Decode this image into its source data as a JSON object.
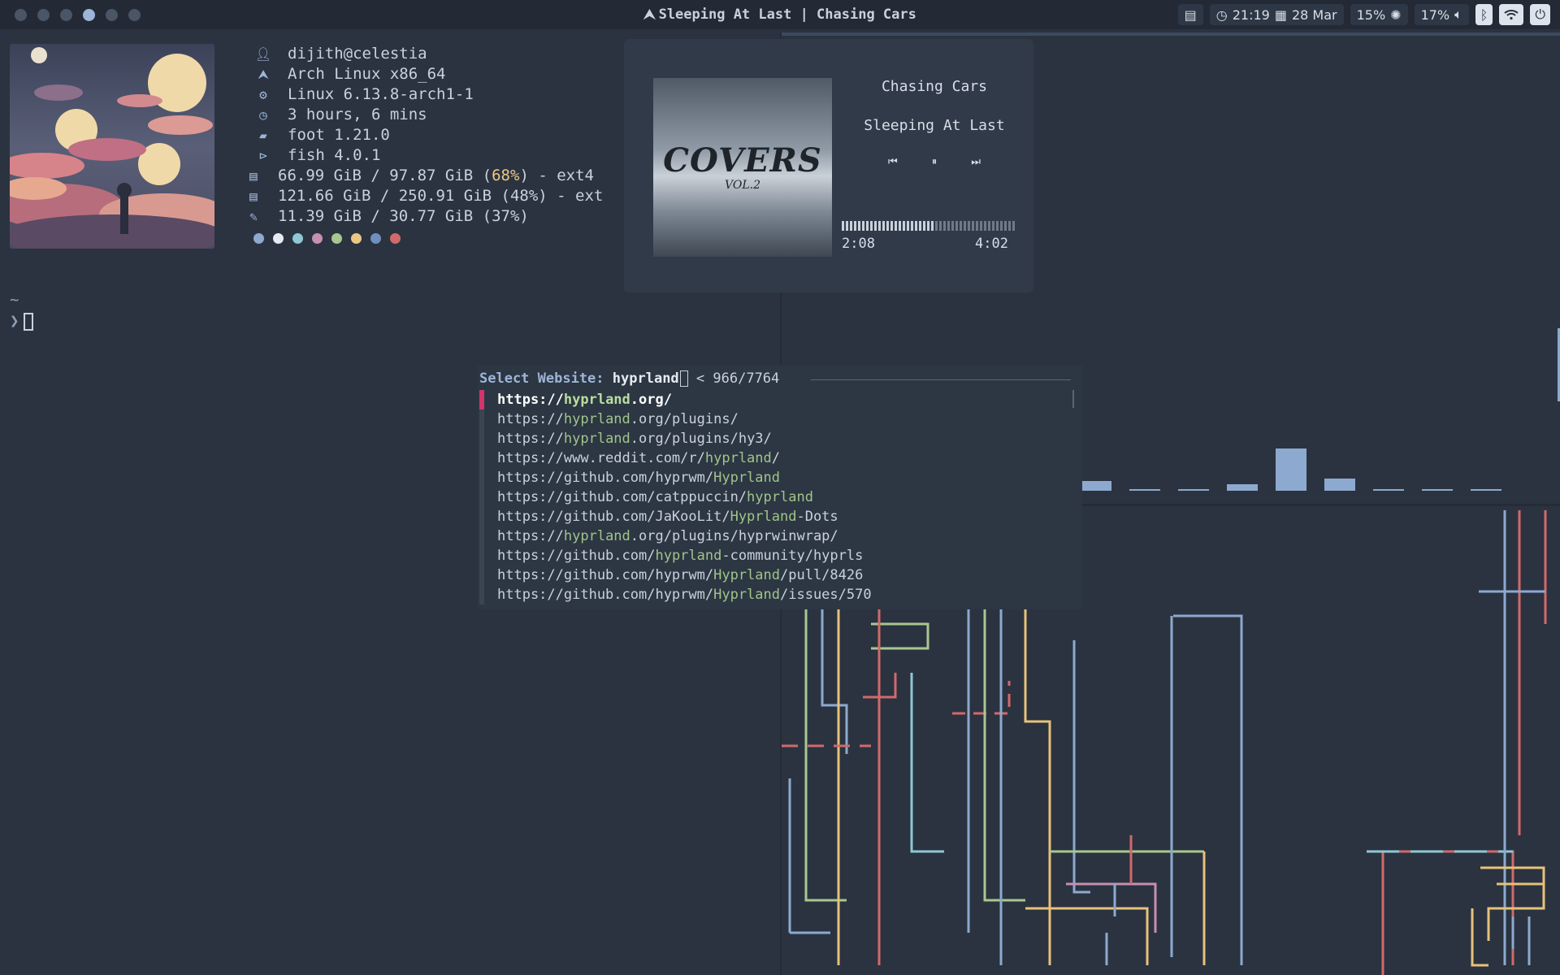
{
  "topbar": {
    "window_title": "Sleeping At Last | Chasing Cars",
    "workspaces": [
      1,
      2,
      3,
      4,
      5,
      6
    ],
    "active_workspace": 4,
    "time": "21:19",
    "date": "28 Mar",
    "brightness": "15%",
    "volume": "17%",
    "icons": [
      "clipboard-icon",
      "clock-icon",
      "calendar-icon",
      "brightness-icon",
      "volume-icon",
      "bluetooth-icon",
      "wifi-icon",
      "power-icon"
    ]
  },
  "fetch": {
    "rows": [
      {
        "icon": "user-icon",
        "text": "dijith@celestia"
      },
      {
        "icon": "arch-icon",
        "text": "Arch Linux x86_64"
      },
      {
        "icon": "gear-icon",
        "text": "Linux 6.13.8-arch1-1"
      },
      {
        "icon": "clock-icon",
        "text": "3 hours, 6 mins"
      },
      {
        "icon": "terminal-icon",
        "text": "foot 1.21.0"
      },
      {
        "icon": "shell-icon",
        "text": "fish 4.0.1"
      },
      {
        "icon": "disk-icon",
        "pre": "66.99 GiB / 97.87 GiB (",
        "hl": "68%",
        "post": ") - ext4"
      },
      {
        "icon": "disk-icon",
        "text": "121.66 GiB / 250.91 GiB (48%) - ext"
      },
      {
        "icon": "memory-icon",
        "text": "11.39 GiB / 30.77 GiB (37%)"
      }
    ],
    "palette": [
      "#8da9cf",
      "#e6ebf2",
      "#8fc7d3",
      "#c78fb0",
      "#a8c78f",
      "#eac787",
      "#6f8fc0",
      "#d16a6a"
    ]
  },
  "prompt": {
    "dir": "~",
    "symbol": "❯"
  },
  "player": {
    "album_art_text": "COVERS",
    "album_art_sub": "VOL.2",
    "song": "Chasing Cars",
    "artist": "Sleeping At Last",
    "elapsed": "2:08",
    "duration": "4:02",
    "progress": 0.53
  },
  "launcher": {
    "prompt_label": "Select Website:",
    "query": "hyprland",
    "count": "< 966/7764",
    "items": [
      {
        "pre": "https://",
        "match": "hyprland",
        "post": ".org/"
      },
      {
        "pre": "https://",
        "match": "hyprland",
        "post": ".org/plugins/"
      },
      {
        "pre": "https://",
        "match": "hyprland",
        "post": ".org/plugins/hy3/"
      },
      {
        "pre": "https://www.reddit.com/r/",
        "match": "hyprland",
        "post": "/"
      },
      {
        "pre": "https://github.com/hyprwm/",
        "match": "Hyprland",
        "post": ""
      },
      {
        "pre": "https://github.com/catppuccin/",
        "match": "hyprland",
        "post": ""
      },
      {
        "pre": "https://github.com/JaKooLit/",
        "match": "Hyprland",
        "post": "-Dots"
      },
      {
        "pre": "https://",
        "match": "hyprland",
        "post": ".org/plugins/hyprwinwrap/"
      },
      {
        "pre": "https://github.com/",
        "match": "hyprland",
        "post": "-community/hyprls"
      },
      {
        "pre": "https://github.com/hyprwm/",
        "match": "Hyprland",
        "post": "/pull/8426"
      },
      {
        "pre": "https://github.com/hyprwm/",
        "match": "Hyprland",
        "post": "/issues/570"
      }
    ]
  },
  "visualizer": {
    "levels": [
      0.16,
      0.03,
      0.03,
      0.11,
      0.69,
      0.2,
      0.03,
      0.03,
      0.03
    ]
  }
}
